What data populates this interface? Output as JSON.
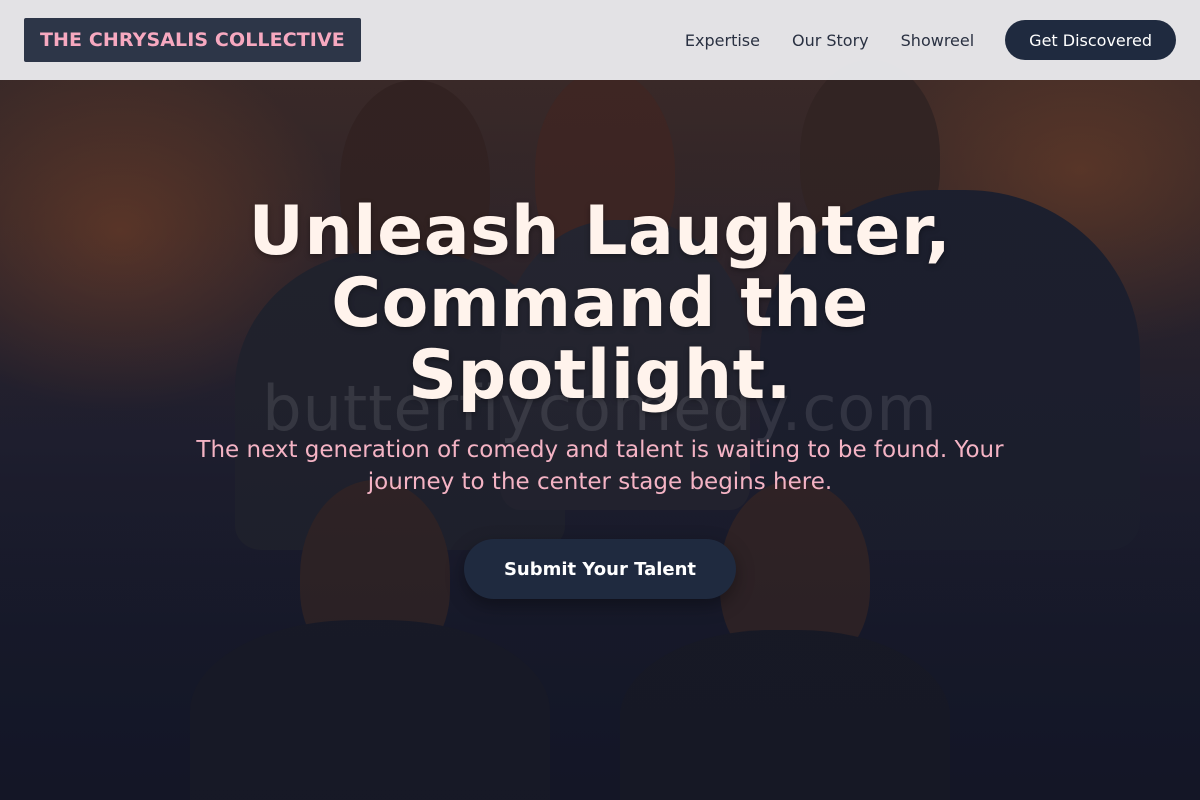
{
  "header": {
    "logo_text": "THE CHRYSALIS COLLECTIVE",
    "nav": [
      "Expertise",
      "Our Story",
      "Showreel"
    ],
    "cta_label": "Get Discovered"
  },
  "hero": {
    "title": "Unleash Laughter, Command the Spotlight.",
    "subtitle": "The next generation of comedy and talent is waiting to be found. Your journey to the center stage begins here.",
    "cta_label": "Submit Your Talent",
    "watermark": "butterflycomedy.com"
  },
  "colors": {
    "header_bg": "#e8e8eb",
    "logo_bg": "#2d3648",
    "logo_text": "#f7a9c0",
    "button_bg": "#1f2a3f",
    "title_text": "#fff3ec",
    "subtitle_text": "#f4b3c4"
  }
}
